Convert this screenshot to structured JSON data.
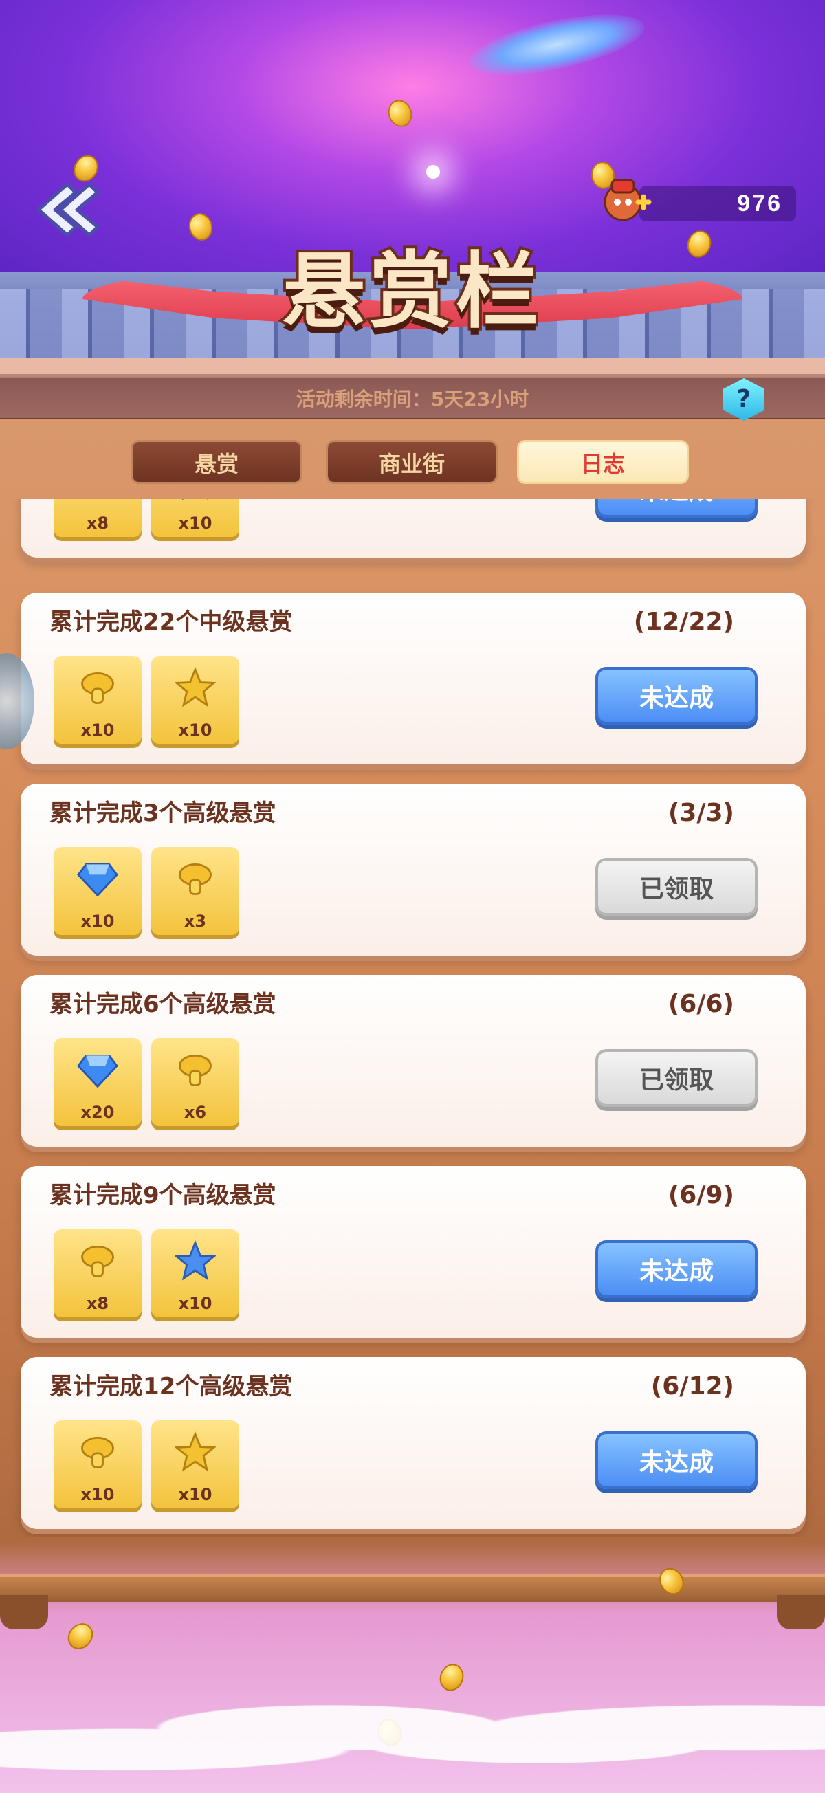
{
  "header": {
    "title": "悬赏栏",
    "currency_value": "976",
    "timer_text": "活动剩余时间：5天23小时",
    "help_label": "?"
  },
  "tabs": [
    {
      "label": "悬赏",
      "active": false
    },
    {
      "label": "商业街",
      "active": false
    },
    {
      "label": "日志",
      "active": true
    }
  ],
  "tasks": [
    {
      "title": "",
      "progress": "",
      "rewards": [
        {
          "icon": "mushroom-icon",
          "qty": "x8"
        },
        {
          "icon": "blue-star-icon",
          "qty": "x10"
        }
      ],
      "button": "未达成",
      "button_state": "blue"
    },
    {
      "title": "累计完成22个中级悬赏",
      "progress": "(12/22)",
      "rewards": [
        {
          "icon": "mushroom-icon",
          "qty": "x10"
        },
        {
          "icon": "gold-star-icon",
          "qty": "x10"
        }
      ],
      "button": "未达成",
      "button_state": "blue"
    },
    {
      "title": "累计完成3个高级悬赏",
      "progress": "(3/3)",
      "rewards": [
        {
          "icon": "diamond-icon",
          "qty": "x10"
        },
        {
          "icon": "mushroom-icon",
          "qty": "x3"
        }
      ],
      "button": "已领取",
      "button_state": "gray"
    },
    {
      "title": "累计完成6个高级悬赏",
      "progress": "(6/6)",
      "rewards": [
        {
          "icon": "diamond-icon",
          "qty": "x20"
        },
        {
          "icon": "mushroom-icon",
          "qty": "x6"
        }
      ],
      "button": "已领取",
      "button_state": "gray"
    },
    {
      "title": "累计完成9个高级悬赏",
      "progress": "(6/9)",
      "rewards": [
        {
          "icon": "mushroom-icon",
          "qty": "x8"
        },
        {
          "icon": "blue-star-icon",
          "qty": "x10"
        }
      ],
      "button": "未达成",
      "button_state": "blue"
    },
    {
      "title": "累计完成12个高级悬赏",
      "progress": "(6/12)",
      "rewards": [
        {
          "icon": "mushroom-icon",
          "qty": "x10"
        },
        {
          "icon": "gold-star-icon",
          "qty": "x10"
        }
      ],
      "button": "未达成",
      "button_state": "blue"
    }
  ],
  "colors": {
    "accent_red": "#e03a33",
    "button_blue": "#4c8ef5",
    "text_brown": "#6b3220"
  }
}
